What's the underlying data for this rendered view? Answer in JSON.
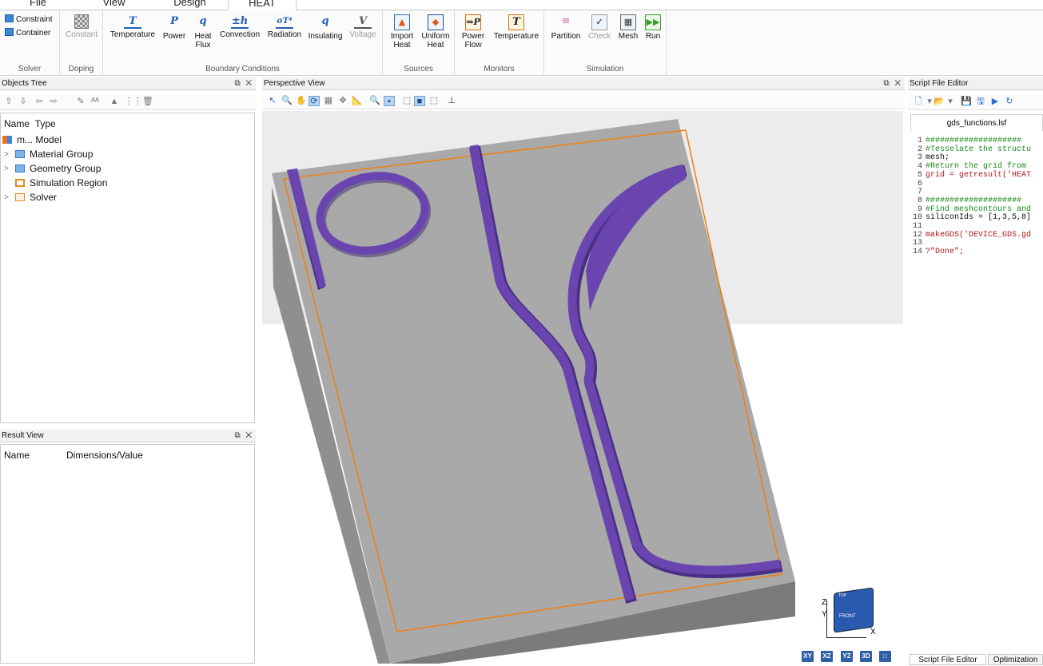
{
  "menu": {
    "tabs": [
      {
        "label": "File"
      },
      {
        "label": "View"
      },
      {
        "label": "Design"
      },
      {
        "label": "HEAT"
      }
    ]
  },
  "ribbon": {
    "solver": {
      "label": "Solver",
      "buttons": [
        "Constraint",
        "Container"
      ]
    },
    "doping": {
      "label": "Doping",
      "buttons": [
        "Constant"
      ]
    },
    "boundary": {
      "label": "Boundary Conditions",
      "buttons": [
        {
          "label": "Temperature",
          "glyph": "T"
        },
        {
          "label": "Power",
          "glyph": "P"
        },
        {
          "label": "Heat\nFlux",
          "glyph": "q"
        },
        {
          "label": "Convection",
          "glyph": "±h"
        },
        {
          "label": "Radiation",
          "glyph": "σT⁴"
        },
        {
          "label": "Insulating",
          "glyph": "q"
        },
        {
          "label": "Voltage",
          "glyph": "V"
        }
      ]
    },
    "sources": {
      "label": "Sources",
      "buttons": [
        "Import\nHeat",
        "Uniform\nHeat"
      ]
    },
    "monitors": {
      "label": "Monitors",
      "buttons": [
        "Power\nFlow",
        "Temperature"
      ]
    },
    "simulation": {
      "label": "Simulation",
      "buttons": [
        "Partition",
        "Check",
        "Mesh",
        "Run"
      ]
    }
  },
  "objects_tree": {
    "title": "Objects Tree",
    "columns": [
      "Name",
      "Type"
    ],
    "rows": [
      {
        "name": "m...",
        "type": "Model"
      },
      {
        "name": "",
        "type": "Material Group"
      },
      {
        "name": "",
        "type": "Geometry Group"
      },
      {
        "name": "",
        "type": "Simulation Region"
      },
      {
        "name": "",
        "type": "Solver"
      }
    ]
  },
  "result_view": {
    "title": "Result View",
    "columns": [
      "Name",
      "Dimensions/Value"
    ]
  },
  "perspective": {
    "title": "Perspective View",
    "axis_labels": {
      "z": "Z",
      "y": "Y",
      "x": "X",
      "top": "TOP",
      "front": "FRONT"
    },
    "view_buttons": [
      "XY",
      "XZ",
      "YZ",
      "3D",
      "□"
    ]
  },
  "script_editor": {
    "title": "Script File Editor",
    "file_tab": "gds_functions.lsf",
    "lines": [
      {
        "n": "1",
        "text": "####################",
        "kind": "comment"
      },
      {
        "n": "2",
        "text": "#Tesselate the structu",
        "kind": "comment"
      },
      {
        "n": "3",
        "text": "mesh;",
        "kind": "code"
      },
      {
        "n": "4",
        "text": "#Return the grid from ",
        "kind": "comment"
      },
      {
        "n": "5",
        "text": "grid = getresult('HEAT",
        "kind": "mixed"
      },
      {
        "n": "6",
        "text": "",
        "kind": "code"
      },
      {
        "n": "7",
        "text": "",
        "kind": "code"
      },
      {
        "n": "8",
        "text": "####################",
        "kind": "comment"
      },
      {
        "n": "9",
        "text": "#Find meshcontours and",
        "kind": "comment"
      },
      {
        "n": "10",
        "text": "siliconIds = [1,3,5,8]",
        "kind": "code"
      },
      {
        "n": "11",
        "text": "",
        "kind": "code"
      },
      {
        "n": "12",
        "text": "makeGDS('DEVICE_GDS.gd",
        "kind": "mixed"
      },
      {
        "n": "13",
        "text": "",
        "kind": "code"
      },
      {
        "n": "14",
        "text": "?\"Done\";",
        "kind": "mixed"
      }
    ],
    "bottom_tabs": [
      "Script File Editor",
      "Optimization"
    ]
  },
  "colors": {
    "waveguide": "#6a45b0",
    "substrate_top": "#a9a9a9",
    "region_outline": "#f07f10"
  }
}
